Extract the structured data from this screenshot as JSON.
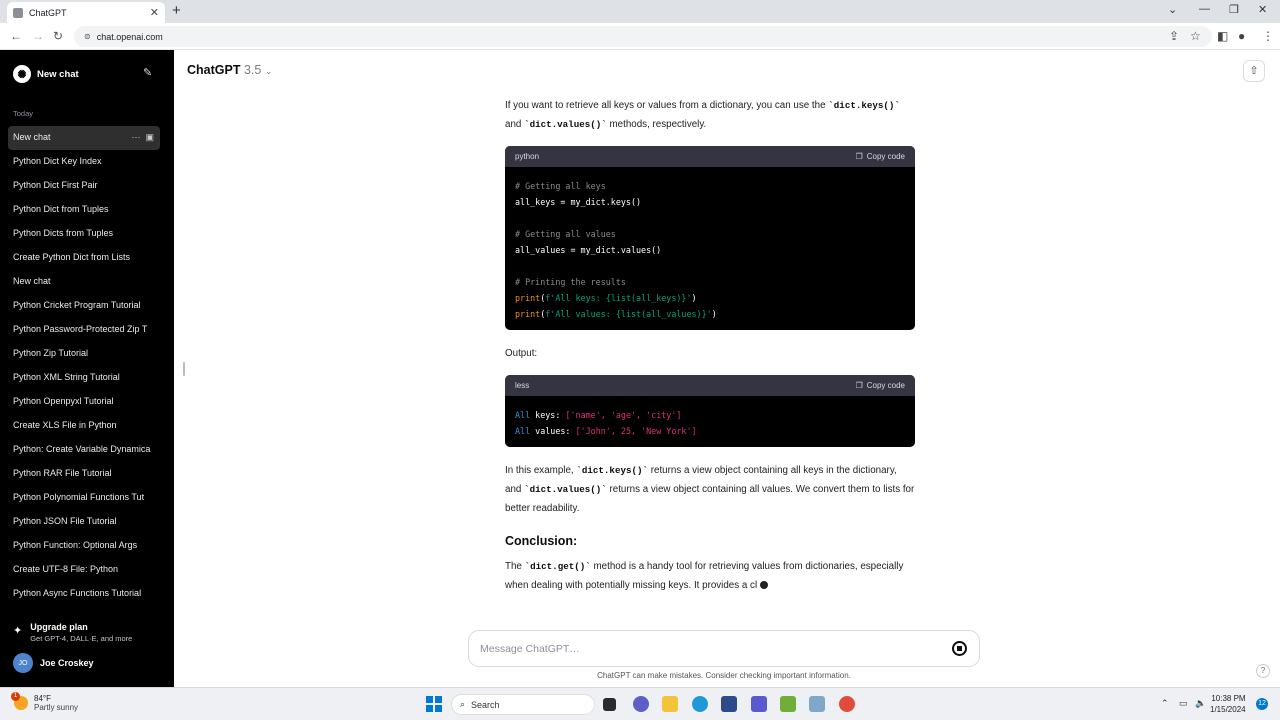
{
  "browser": {
    "tab_title": "ChatGPT",
    "new_tab_icon": "+",
    "url": "chat.openai.com"
  },
  "sidebar": {
    "new_chat_label": "New chat",
    "section_label": "Today",
    "items": [
      {
        "label": "New chat"
      },
      {
        "label": "Python Dict Key Index"
      },
      {
        "label": "Python Dict First Pair"
      },
      {
        "label": "Python Dict from Tuples"
      },
      {
        "label": "Python Dicts from Tuples"
      },
      {
        "label": "Create Python Dict from Lists"
      },
      {
        "label": "New chat"
      },
      {
        "label": "Python Cricket Program Tutorial"
      },
      {
        "label": "Python Password-Protected Zip T"
      },
      {
        "label": "Python Zip Tutorial"
      },
      {
        "label": "Python XML String Tutorial"
      },
      {
        "label": "Python Openpyxl Tutorial"
      },
      {
        "label": "Create XLS File in Python"
      },
      {
        "label": "Python: Create Variable Dynamica"
      },
      {
        "label": "Python RAR File Tutorial"
      },
      {
        "label": "Python Polynomial Functions Tut"
      },
      {
        "label": "Python JSON File Tutorial"
      },
      {
        "label": "Python Function: Optional Args"
      },
      {
        "label": "Create UTF-8 File: Python"
      },
      {
        "label": "Python Async Functions Tutorial"
      }
    ],
    "upgrade_title": "Upgrade plan",
    "upgrade_sub": "Get GPT-4, DALL·E, and more",
    "user_initials": "JO",
    "user_name": "Joe Croskey"
  },
  "header": {
    "model_name": "ChatGPT",
    "model_version": "3.5"
  },
  "message": {
    "p1_a": "If you want to retrieve all keys or values from a dictionary, you can use the",
    "p1_code1": "`dict.keys()`",
    "p1_and": " and ",
    "p1_code2": "`dict.values()`",
    "p1_b": " methods, respectively.",
    "code1_lang": "python",
    "copy_label": "Copy code",
    "code1": {
      "l1": "# Getting all keys",
      "l2a": "all_keys = my_dict.keys()",
      "l3": "# Getting all values",
      "l4a": "all_values = my_dict.values()",
      "l5": "# Printing the results",
      "l6_fn": "print",
      "l6_open": "(",
      "l6_str1": "f'All keys: {",
      "l6_inner": "list(all_keys)",
      "l6_str2": "}'",
      "l6_close": ")",
      "l7_fn": "print",
      "l7_open": "(",
      "l7_str1": "f'All values: {",
      "l7_inner": "list(all_values)",
      "l7_str2": "}'",
      "l7_close": ")"
    },
    "output_label": "Output:",
    "code2_lang": "less",
    "code2": {
      "l1_kw": "All",
      "l1_txt": " keys: ",
      "l1_arr": "['name', 'age', 'city']",
      "l2_kw": "All",
      "l2_txt": " values: ",
      "l2_arr": "['John', 25, 'New York']"
    },
    "p2_a": "In this example, ",
    "p2_code1": "`dict.keys()`",
    "p2_b": " returns a view object containing all keys in the dictionary, and ",
    "p2_code2": "`dict.values()`",
    "p2_c": " returns a view object containing all values. We convert them to lists for better readability.",
    "conclusion_heading": "Conclusion:",
    "p3_a": "The ",
    "p3_code": "`dict.get()`",
    "p3_b": " method is a handy tool for retrieving values from dictionaries, especially when dealing with potentially missing keys. It provides a cl"
  },
  "composer": {
    "placeholder": "Message ChatGPT…",
    "disclaimer": "ChatGPT can make mistakes. Consider checking important information.",
    "help_label": "?"
  },
  "taskbar": {
    "weather_temp": "84°F",
    "weather_desc": "Partly sunny",
    "weather_badge": "1",
    "search_label": "Search",
    "time": "10:38 PM",
    "date": "1/15/2024",
    "notifications": "12"
  }
}
